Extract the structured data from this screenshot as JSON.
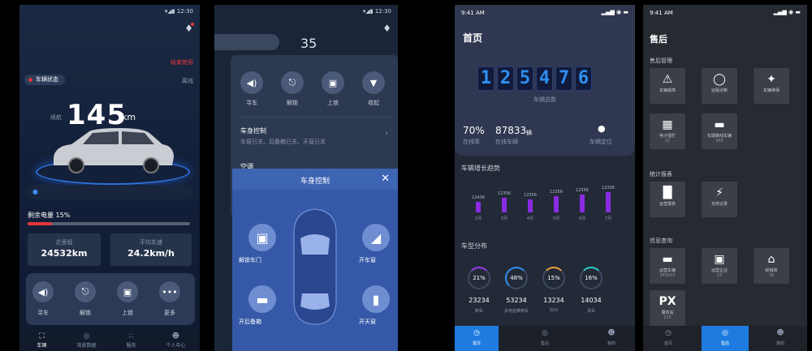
{
  "s1": {
    "status": "▾◢▮ 12:30",
    "end_use": "结束使用",
    "vehicle_status": "车辆状态",
    "offline": "离线",
    "range_label": "续航",
    "range_value": "145",
    "range_unit": "km",
    "battery_label": "剩余电量 15%",
    "battery_level": 0.15,
    "mileage_label": "总里程",
    "mileage_value": "24532km",
    "speed_label": "平均车速",
    "speed_value": "24.2km/h",
    "controls": [
      "寻车",
      "解锁",
      "上锁",
      "更多"
    ],
    "tabs": [
      "车辆",
      "驾驶数据",
      "服务",
      "个人中心"
    ]
  },
  "s2": {
    "status": "▾◢▮ 12:30",
    "number": "35",
    "controls": [
      "寻车",
      "解锁",
      "上锁",
      "收起"
    ],
    "body_control_title": "车身控制",
    "body_control_desc": "车窗已关、后备箱已关、天窗已关",
    "ac_title": "空调",
    "modal_title": "车身控制",
    "unlock_doors": "解锁车门",
    "open_windows": "开车窗",
    "open_trunk": "开后备箱",
    "open_sunroof": "开天窗"
  },
  "s3": {
    "time": "9:41 AM",
    "title": "首页",
    "digits": [
      "1",
      "2",
      "5",
      "4",
      "7",
      "6"
    ],
    "total_label": "车辆总数",
    "online_rate": "70%",
    "online_rate_label": "在线率",
    "online_count": "87833",
    "online_count_unit": "辆",
    "online_count_label": "在线车辆",
    "locate_label": "车辆定位",
    "trend_title": "车辆增长趋势",
    "trend_values": [
      "12436",
      "12356",
      "12356",
      "12356",
      "12356",
      "12356"
    ],
    "trend_months": [
      "2月",
      "3月",
      "4月",
      "5月",
      "6月",
      "7月"
    ],
    "trend_heights": [
      0.35,
      0.5,
      0.45,
      0.55,
      0.6,
      0.7
    ],
    "dist_title": "车型分布",
    "rings": [
      "21%",
      "48%",
      "15%",
      "16%"
    ],
    "ring_values": [
      "23234",
      "53234",
      "13234",
      "14034"
    ],
    "ring_labels": [
      "轿车",
      "多用途乘用车",
      "SUV",
      "货车"
    ],
    "tabs": [
      "首页",
      "售后",
      "我的"
    ]
  },
  "s4": {
    "time": "9:41 AM",
    "title": "售后",
    "sec1": "售后管理",
    "tiles1": [
      "车辆故障",
      "远程诊断",
      "车辆维保"
    ],
    "fence_label": "电子围栏",
    "fence_count": "32",
    "longstop_label": "长期离线车辆",
    "longstop_count": "345",
    "sec2": "统计报表",
    "tiles2": [
      "运营报表",
      "充电记录"
    ],
    "sec3": "信息查询",
    "tiles3": [
      "运营车辆",
      "运营企业",
      "经销商"
    ],
    "tiles3_counts": [
      "345633",
      "23",
      "36"
    ],
    "service": "服务站",
    "service_count": "125",
    "tabs": [
      "首页",
      "售后",
      "我的"
    ]
  }
}
